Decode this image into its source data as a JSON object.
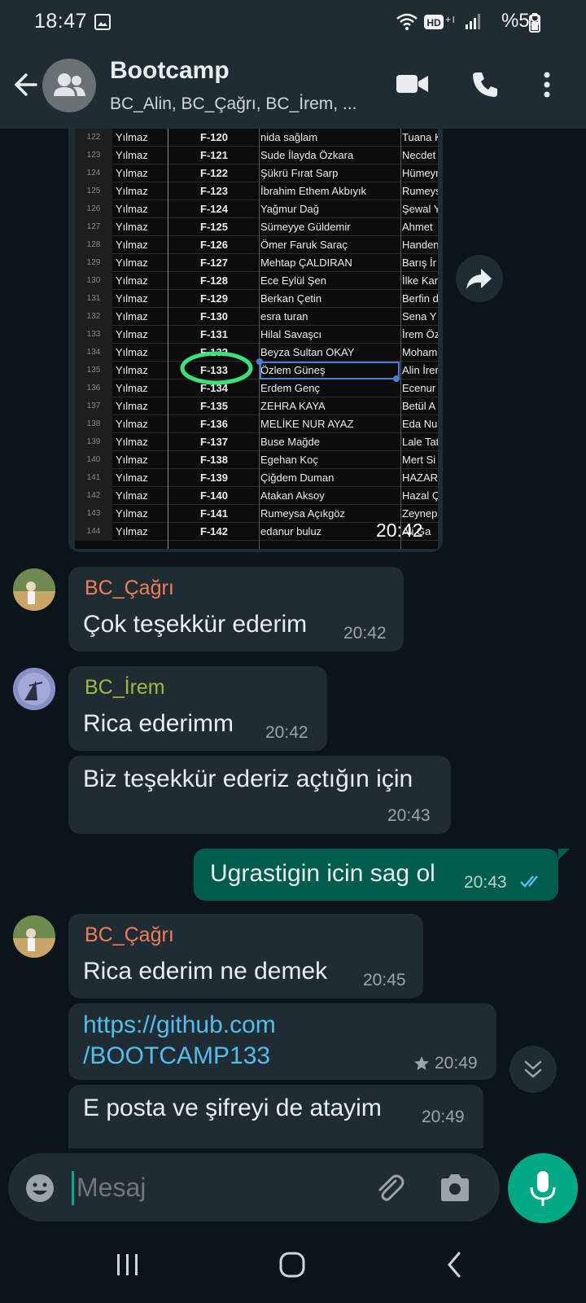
{
  "status": {
    "time": "18:47",
    "battery": "%59"
  },
  "header": {
    "title": "Bootcamp",
    "members": "BC_Alin, BC_Çağrı, BC_İrem, ..."
  },
  "image_msg": {
    "time": "20:42",
    "rows": [
      {
        "n": "122",
        "a": "Yılmaz",
        "code": "F-120",
        "name": "nida sağlam",
        "d": "Tuana K"
      },
      {
        "n": "123",
        "a": "Yılmaz",
        "code": "F-121",
        "name": "Sude İlayda Özkara",
        "d": "Necdet"
      },
      {
        "n": "124",
        "a": "Yılmaz",
        "code": "F-122",
        "name": "Şükrü Fırat Sarp",
        "d": "Hümeyr"
      },
      {
        "n": "125",
        "a": "Yılmaz",
        "code": "F-123",
        "name": "İbrahim Ethem Akbıyık",
        "d": "Rumeys"
      },
      {
        "n": "126",
        "a": "Yılmaz",
        "code": "F-124",
        "name": "Yağmur Dağ",
        "d": "Şewal Y"
      },
      {
        "n": "127",
        "a": "Yılmaz",
        "code": "F-125",
        "name": "Sümeyye Güldemir",
        "d": "Ahmet"
      },
      {
        "n": "128",
        "a": "Yılmaz",
        "code": "F-126",
        "name": "Ömer Faruk Saraç",
        "d": "Handen"
      },
      {
        "n": "129",
        "a": "Yılmaz",
        "code": "F-127",
        "name": "Mehtap ÇALDIRAN",
        "d": "Barış İr"
      },
      {
        "n": "130",
        "a": "Yılmaz",
        "code": "F-128",
        "name": "Ece Eylül Şen",
        "d": "İlke Kar"
      },
      {
        "n": "131",
        "a": "Yılmaz",
        "code": "F-129",
        "name": "Berkan Çetin",
        "d": "Berfin d"
      },
      {
        "n": "132",
        "a": "Yılmaz",
        "code": "F-130",
        "name": "esra turan",
        "d": "Sena Y"
      },
      {
        "n": "133",
        "a": "Yılmaz",
        "code": "F-131",
        "name": "Hilal Savaşcı",
        "d": "İrem Öz"
      },
      {
        "n": "134",
        "a": "Yılmaz",
        "code": "F-132",
        "name": "Beyza Sultan OKAY",
        "d": "Moham"
      },
      {
        "n": "135",
        "a": "Yılmaz",
        "code": "F-133",
        "name": "Özlem Güneş",
        "d": "Alin İrer"
      },
      {
        "n": "136",
        "a": "Yılmaz",
        "code": "F-134",
        "name": "Erdem Genç",
        "d": "Ecenur"
      },
      {
        "n": "137",
        "a": "Yılmaz",
        "code": "F-135",
        "name": "ZEHRA KAYA",
        "d": "Betül A"
      },
      {
        "n": "138",
        "a": "Yılmaz",
        "code": "F-136",
        "name": "MELİKE NUR AYAZ",
        "d": "Eda Nu"
      },
      {
        "n": "139",
        "a": "Yılmaz",
        "code": "F-137",
        "name": "Buse Mağde",
        "d": "Lale Tat"
      },
      {
        "n": "140",
        "a": "Yılmaz",
        "code": "F-138",
        "name": "Egehan Koç",
        "d": "Mert Si"
      },
      {
        "n": "141",
        "a": "Yılmaz",
        "code": "F-139",
        "name": "Çiğdem Duman",
        "d": "HAZAR"
      },
      {
        "n": "142",
        "a": "Yılmaz",
        "code": "F-140",
        "name": "Atakan Aksoy",
        "d": "Hazal Ç"
      },
      {
        "n": "143",
        "a": "Yılmaz",
        "code": "F-141",
        "name": "Rumeysa Açıkgöz",
        "d": "Zeynep"
      },
      {
        "n": "144",
        "a": "Yılmaz",
        "code": "F-142",
        "name": "edanur buluz",
        "d": "Ali Ga"
      }
    ]
  },
  "messages": {
    "m1": {
      "sender": "BC_Çağrı",
      "text": "Çok teşekkür ederim",
      "time": "20:42"
    },
    "m2": {
      "sender": "BC_İrem",
      "text": "Rica ederimm",
      "time": "20:42"
    },
    "m3": {
      "text": "Biz teşekkür ederiz açtığın için",
      "time": "20:43"
    },
    "m4": {
      "text": "Ugrastigin icin sag ol",
      "time": "20:43"
    },
    "m5": {
      "sender": "BC_Çağrı",
      "text": "Rica ederim ne demek",
      "time": "20:45"
    },
    "m6": {
      "link_line1": "https://github.com",
      "link_line2": "/BOOTCAMP133",
      "time": "20:49"
    },
    "m7": {
      "text": "E posta ve şifreyi de atayim",
      "time": "20:49"
    }
  },
  "composer": {
    "placeholder": "Mesaj"
  },
  "colors": {
    "cagri": "#f07e56",
    "irem": "#a5b93b",
    "accent": "#00a884",
    "outgoing": "#005c4b"
  }
}
